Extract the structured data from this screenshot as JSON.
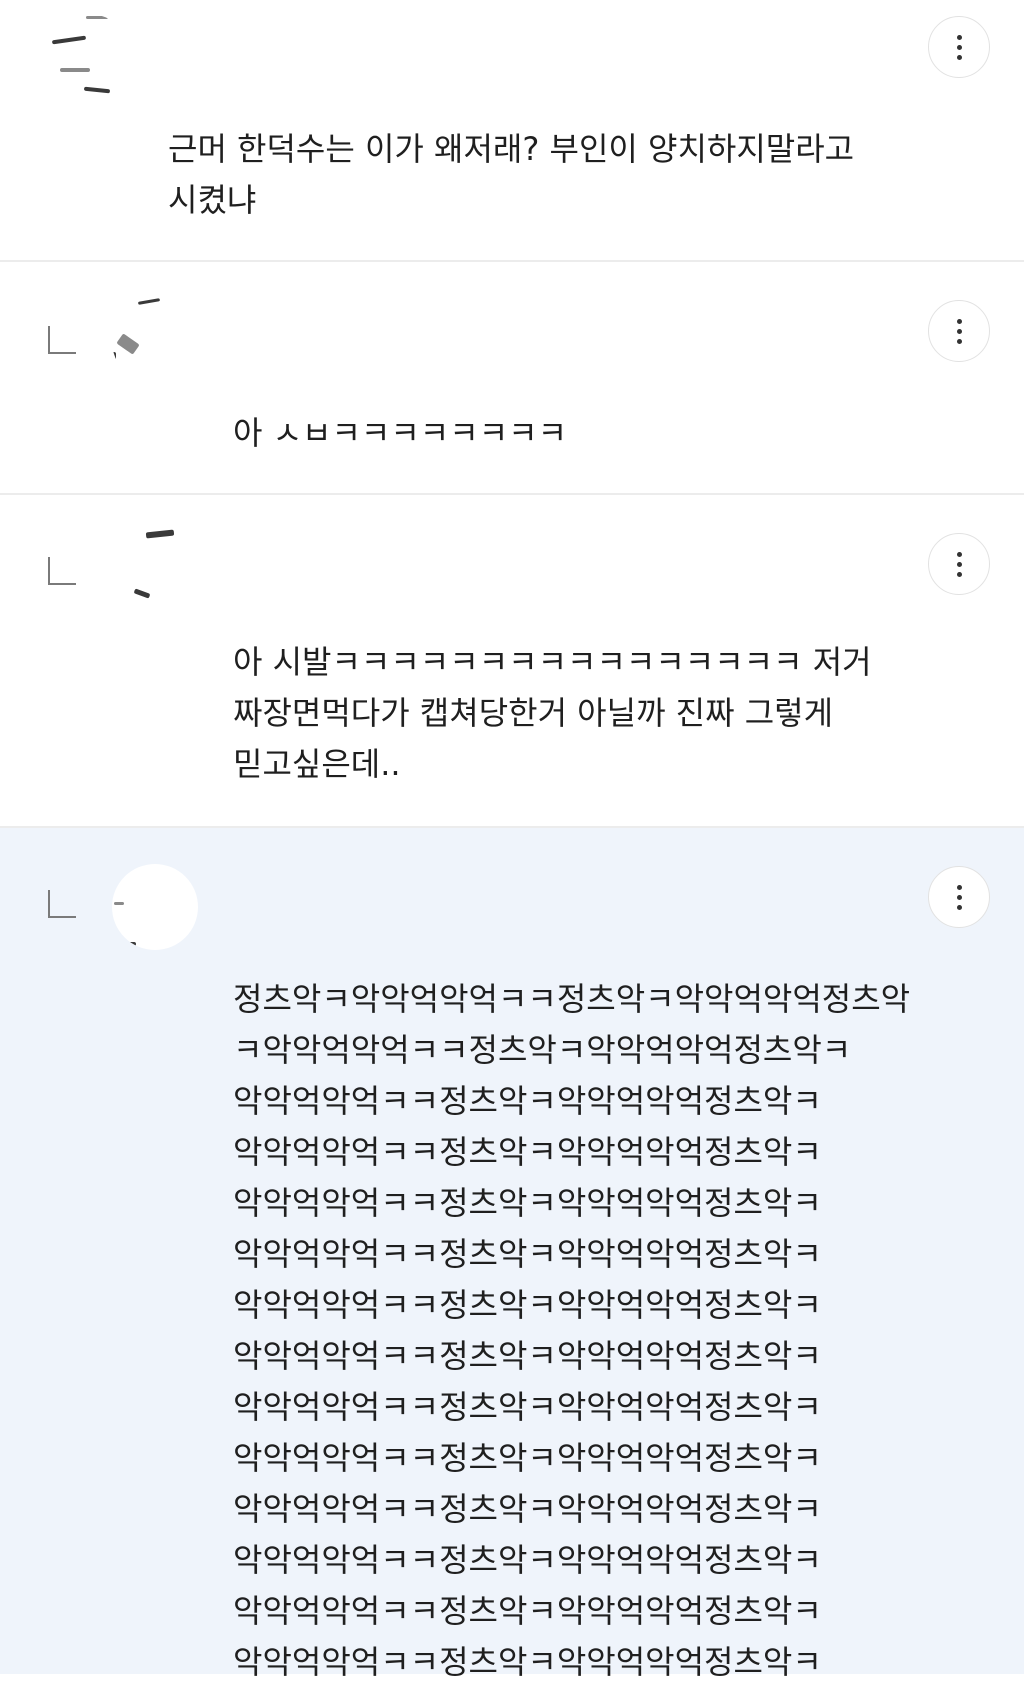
{
  "comments": [
    {
      "text": "근머 한덕수는 이가 왜저래? 부인이 양치하지말라고\n시켰냐",
      "is_reply": false
    },
    {
      "text": "아 ㅅㅂㅋㅋㅋㅋㅋㅋㅋㅋ",
      "is_reply": true
    },
    {
      "text": "아 시발ㅋㅋㅋㅋㅋㅋㅋㅋㅋㅋㅋㅋㅋㅋㅋㅋ 저거\n짜장면먹다가 캡쳐당한거 아닐까 진짜 그렇게\n믿고싶은데..",
      "is_reply": true
    },
    {
      "text": "정츠악ㅋ악악억악억ㅋㅋ정츠악ㅋ악악억악억정츠악\nㅋ악악억악억ㅋㅋ정츠악ㅋ악악억악억정츠악ㅋ\n악악억악억ㅋㅋ정츠악ㅋ악악억악억정츠악ㅋ\n악악억악억ㅋㅋ정츠악ㅋ악악억악억정츠악ㅋ\n악악억악억ㅋㅋ정츠악ㅋ악악억악억정츠악ㅋ\n악악억악억ㅋㅋ정츠악ㅋ악악억악억정츠악ㅋ\n악악억악억ㅋㅋ정츠악ㅋ악악억악억정츠악ㅋ\n악악억악억ㅋㅋ정츠악ㅋ악악억악억정츠악ㅋ\n악악억악억ㅋㅋ정츠악ㅋ악악억악억정츠악ㅋ\n악악억악억ㅋㅋ정츠악ㅋ악악억악억정츠악ㅋ\n악악억악억ㅋㅋ정츠악ㅋ악악억악억정츠악ㅋ\n악악억악억ㅋㅋ정츠악ㅋ악악억악억정츠악ㅋ\n악악억악억ㅋㅋ정츠악ㅋ악악억악억정츠악ㅋ\n악악억악억ㅋㅋ정츠악ㅋ악악억악억정츠악ㅋ",
      "is_reply": true
    }
  ],
  "icons": {
    "more": "more-vertical-icon",
    "reply": "reply-arrow-icon",
    "avatar": "avatar-image"
  },
  "colors": {
    "background": "#ffffff",
    "highlight_background": "#eff4fb",
    "divider": "#ececec",
    "text": "#1f1f1f"
  }
}
